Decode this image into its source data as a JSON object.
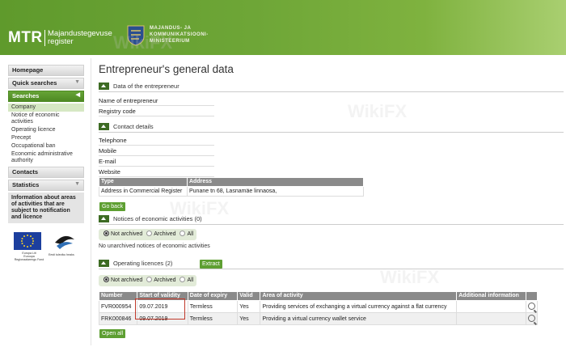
{
  "header": {
    "logo": "MTR",
    "logo_sub_1": "Majandustegevuse",
    "logo_sub_2": "register",
    "ministry_1": "MAJANDUS- JA",
    "ministry_2": "KOMMUNIKATSIOONI-",
    "ministry_3": "MINISTEERIUM",
    "brand_color": "#6ea637"
  },
  "sidebar": {
    "homepage": "Homepage",
    "quick_searches": "Quick searches",
    "searches": "Searches",
    "search_items": [
      "Company",
      "Notice of economic activities",
      "Operating licence",
      "Precept",
      "Occupational ban",
      "Economic administrative authority"
    ],
    "contacts": "Contacts",
    "statistics": "Statistics",
    "info": "Information about areas of activities that are subject to notification and licence",
    "eu_text_1": "Europa Liit",
    "eu_text_2": "Euroopa",
    "eu_text_3": "Regionaalarengu Fond",
    "est_text": "Eesti tuleviku heaks"
  },
  "main": {
    "title": "Entrepreneur's general data",
    "sec_entrepreneur": "Data of the entrepreneur",
    "name_label": "Name of entrepreneur",
    "registry_label": "Registry code",
    "sec_contacts": "Contact details",
    "telephone": "Telephone",
    "mobile": "Mobile",
    "email": "E-mail",
    "website": "Website",
    "addr_type_header": "Type",
    "addr_address_header": "Address",
    "addr_type": "Address in Commercial Register",
    "addr_value": "Punane tn 68, Lasnamäe linnaosa,",
    "go_back": "Go back",
    "sec_notices": "Notices of economic activities (0)",
    "radio_not_archived": "Not archived",
    "radio_archived": "Archived",
    "radio_all": "All",
    "no_notices": "No unarchived notices of economic activities",
    "sec_licences": "Operating licences (2)",
    "extract": "Extract",
    "lic_headers": [
      "Number",
      "Start of validity",
      "Date of expiry",
      "Valid",
      "Area of activity",
      "Additional information"
    ],
    "licences": [
      {
        "number": "FVR000954",
        "start": "09.07.2019",
        "expiry": "Termless",
        "valid": "Yes",
        "area": "Providing services of exchanging a virtual currency against a flat currency",
        "info": ""
      },
      {
        "number": "FRK000846",
        "start": "09.07.2019",
        "expiry": "Termless",
        "valid": "Yes",
        "area": "Providing a virtual currency wallet service",
        "info": ""
      }
    ],
    "open_all": "Open all"
  },
  "watermark": "WikiFX"
}
